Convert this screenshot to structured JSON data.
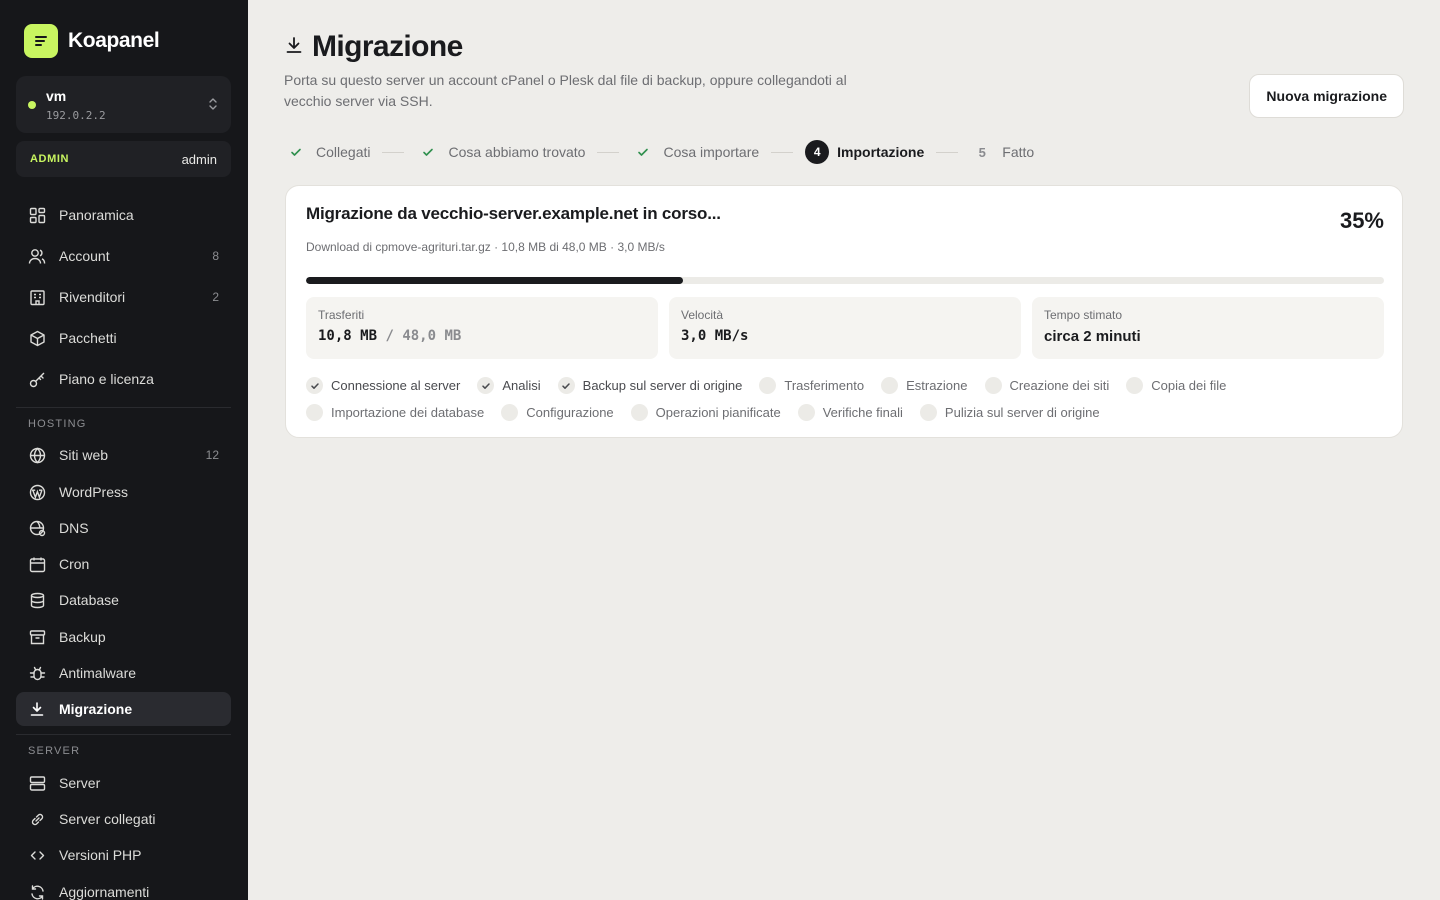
{
  "brand": {
    "name": "Koapanel"
  },
  "server": {
    "name": "vm",
    "ip": "192.0.2.2"
  },
  "role": {
    "badge": "ADMIN",
    "user": "admin"
  },
  "nav": {
    "main": [
      {
        "label": "Panoramica",
        "icon": "grid-icon",
        "count": ""
      },
      {
        "label": "Account",
        "icon": "users-icon",
        "count": "8"
      },
      {
        "label": "Rivenditori",
        "icon": "building-icon",
        "count": "2"
      },
      {
        "label": "Pacchetti",
        "icon": "package-icon",
        "count": ""
      },
      {
        "label": "Piano e licenza",
        "icon": "key-icon",
        "count": ""
      }
    ],
    "hosting_label": "HOSTING",
    "hosting": [
      {
        "label": "Siti web",
        "icon": "globe-icon",
        "count": "12"
      },
      {
        "label": "WordPress",
        "icon": "wordpress-icon",
        "count": ""
      },
      {
        "label": "DNS",
        "icon": "dns-globe-icon",
        "count": ""
      },
      {
        "label": "Cron",
        "icon": "calendar-icon",
        "count": ""
      },
      {
        "label": "Database",
        "icon": "database-icon",
        "count": ""
      },
      {
        "label": "Backup",
        "icon": "archive-icon",
        "count": ""
      },
      {
        "label": "Antimalware",
        "icon": "bug-icon",
        "count": ""
      },
      {
        "label": "Migrazione",
        "icon": "download-icon",
        "count": "",
        "active": true
      }
    ],
    "server_label": "SERVER",
    "server": [
      {
        "label": "Server",
        "icon": "server-icon",
        "count": ""
      },
      {
        "label": "Server collegati",
        "icon": "link-icon",
        "count": ""
      },
      {
        "label": "Versioni PHP",
        "icon": "code-icon",
        "count": ""
      },
      {
        "label": "Aggiornamenti",
        "icon": "refresh-icon",
        "count": ""
      }
    ]
  },
  "page": {
    "title": "Migrazione",
    "description": "Porta su questo server un account cPanel o Plesk dal file di backup, oppure collegandoti al vecchio server via SSH.",
    "new_button": "Nuova migrazione"
  },
  "steps": [
    {
      "label": "Collegati",
      "state": "done",
      "mark": ""
    },
    {
      "label": "Cosa abbiamo trovato",
      "state": "done",
      "mark": ""
    },
    {
      "label": "Cosa importare",
      "state": "done",
      "mark": ""
    },
    {
      "label": "Importazione",
      "state": "current",
      "mark": "4"
    },
    {
      "label": "Fatto",
      "state": "todo",
      "mark": "5"
    }
  ],
  "migration": {
    "title": "Migrazione da vecchio-server.example.net in corso...",
    "percent_label": "35%",
    "progress": 0.35,
    "subtitle": "Download di cpmove-agrituri.tar.gz · 10,8 MB di 48,0 MB · 3,0 MB/s",
    "stats": {
      "transferred": {
        "label": "Trasferiti",
        "done": "10,8 MB",
        "sep": " / ",
        "total": "48,0 MB"
      },
      "speed": {
        "label": "Velocità",
        "value": "3,0 MB/s"
      },
      "eta": {
        "label": "Tempo stimato",
        "value": "circa 2 minuti"
      }
    },
    "tasks_row1": [
      {
        "label": "Connessione al server",
        "done": true
      },
      {
        "label": "Analisi",
        "done": true
      },
      {
        "label": "Backup sul server di origine",
        "done": true
      },
      {
        "label": "Trasferimento",
        "done": false
      },
      {
        "label": "Estrazione",
        "done": false
      },
      {
        "label": "Creazione dei siti",
        "done": false
      },
      {
        "label": "Copia dei file",
        "done": false
      }
    ],
    "tasks_row2": [
      {
        "label": "Importazione dei database",
        "done": false
      },
      {
        "label": "Configurazione",
        "done": false
      },
      {
        "label": "Operazioni pianificate",
        "done": false
      },
      {
        "label": "Verifiche finali",
        "done": false
      },
      {
        "label": "Pulizia sul server di origine",
        "done": false
      }
    ]
  },
  "colors": {
    "accent": "#c8f560",
    "sidebar": "#16171a",
    "background": "#eeedea",
    "ink": "#1a1b1e"
  }
}
